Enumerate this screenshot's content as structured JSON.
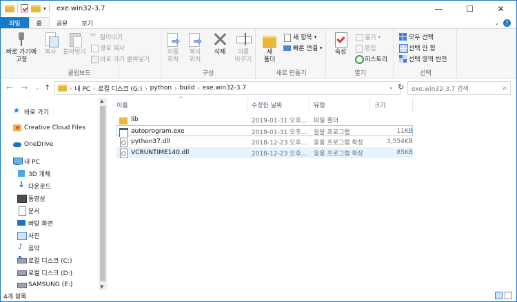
{
  "window": {
    "title": "exe.win32-3.7",
    "minimize": "—",
    "maximize": "☐",
    "close": "✕"
  },
  "ribbon_tabs": {
    "file": "파일",
    "home": "홈",
    "share": "공유",
    "view": "보기"
  },
  "ribbon": {
    "clipboard": {
      "label": "클립보드",
      "pin": "바로 가기에\n고정",
      "copy": "복사",
      "paste": "붙여넣기",
      "cut": "잘라내기",
      "copy_path": "경로 복사",
      "paste_shortcut": "바로 가기 붙여넣기"
    },
    "organize": {
      "label": "구성",
      "move_to": "이동\n위치",
      "copy_to": "복사\n위치",
      "delete": "삭제",
      "rename": "이름\n바꾸기"
    },
    "new": {
      "label": "새로 만들기",
      "new_folder": "새\n폴더",
      "new_item": "새 항목",
      "easy_access": "빠른 연결"
    },
    "open": {
      "label": "열기",
      "properties": "속성",
      "open": "열기",
      "edit": "편집",
      "history": "히스토리"
    },
    "select": {
      "label": "선택",
      "select_all": "모두 선택",
      "select_none": "선택 안 함",
      "invert": "선택 영역 반전"
    }
  },
  "address": {
    "crumbs": [
      "내 PC",
      "로컬 디스크 (G:)",
      "python",
      "build",
      "exe.win32-3.7"
    ],
    "search_placeholder": "exe.win32-3.7 검색"
  },
  "nav": {
    "items": [
      {
        "label": "바로 가기",
        "icon": "star-icon"
      },
      {
        "label": "Creative Cloud Files",
        "icon": "creative-cloud-icon"
      },
      {
        "label": "OneDrive",
        "icon": "onedrive-icon"
      },
      {
        "label": "내 PC",
        "icon": "pc-icon"
      },
      {
        "label": "3D 개체",
        "icon": "cube-icon"
      },
      {
        "label": "다운로드",
        "icon": "download-icon"
      },
      {
        "label": "동영상",
        "icon": "video-icon"
      },
      {
        "label": "문서",
        "icon": "document-icon"
      },
      {
        "label": "바탕 화면",
        "icon": "desktop-icon"
      },
      {
        "label": "사진",
        "icon": "pictures-icon"
      },
      {
        "label": "음악",
        "icon": "music-icon"
      },
      {
        "label": "로컬 디스크 (C:)",
        "icon": "drive-icon"
      },
      {
        "label": "로컬 디스크 (D:)",
        "icon": "drive-icon"
      },
      {
        "label": "SAMSUNG (E:)",
        "icon": "drive-icon"
      }
    ]
  },
  "columns": {
    "name": "이름",
    "date": "수정한 날짜",
    "type": "유형",
    "size": "크기"
  },
  "files": [
    {
      "name": "lib",
      "date": "2019-01-31 오후...",
      "type": "파일 폴더",
      "size": "",
      "icon": "folder-icon"
    },
    {
      "name": "autoprogram.exe",
      "date": "2019-01-31 오후...",
      "type": "응용 프로그램",
      "size": "11KB",
      "icon": "exe-icon"
    },
    {
      "name": "python37.dll",
      "date": "2018-12-23 오후...",
      "type": "응용 프로그램 확장",
      "size": "3,554KB",
      "icon": "dll-icon"
    },
    {
      "name": "VCRUNTIME140.dll",
      "date": "2018-12-23 오후...",
      "type": "응용 프로그램 확장",
      "size": "85KB",
      "icon": "dll-icon"
    }
  ],
  "status": {
    "item_count": "4개 항목"
  }
}
